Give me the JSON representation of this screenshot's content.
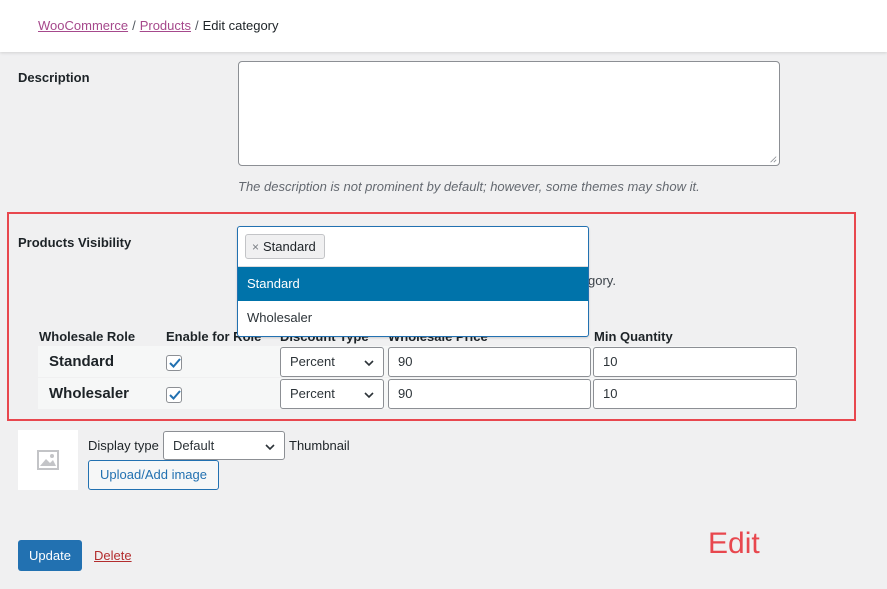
{
  "breadcrumb": {
    "items": [
      "WooCommerce",
      "Products"
    ],
    "current": "Edit category",
    "separator": "/"
  },
  "description": {
    "label": "Description",
    "value": "",
    "hint": "The description is not prominent by default; however, some themes may show it."
  },
  "visibility": {
    "label": "Products Visibility",
    "selected_chip": "Standard",
    "chip_remove": "×",
    "options": [
      {
        "label": "Standard",
        "highlighted": true
      },
      {
        "label": "Wholesaler",
        "highlighted": false
      }
    ],
    "partial_description": "gory."
  },
  "wholesale_table": {
    "headers": [
      "Wholesale Role",
      "Enable for Role",
      "Discount Type",
      "Wholesale Price",
      "Min Quantity"
    ],
    "rows": [
      {
        "role": "Standard",
        "enabled": true,
        "discount_type": "Percent",
        "price": "90",
        "min_qty": "10"
      },
      {
        "role": "Wholesaler",
        "enabled": true,
        "discount_type": "Percent",
        "price": "90",
        "min_qty": "10"
      }
    ]
  },
  "thumbnail": {
    "display_type_label": "Display type",
    "display_type_value": "Default",
    "thumbnail_label": "Thumbnail",
    "upload_button": "Upload/Add image"
  },
  "actions": {
    "update": "Update",
    "delete": "Delete"
  },
  "annotation": {
    "text": "Edit",
    "color": "#e8474e"
  },
  "colors": {
    "primary": "#2271b1",
    "highlight": "#0073aa",
    "link": "#a6498c",
    "delete": "#b32d2e"
  }
}
